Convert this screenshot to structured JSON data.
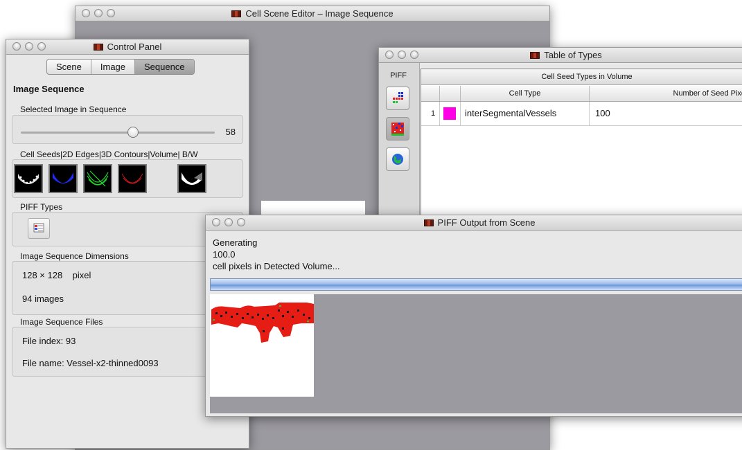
{
  "editor": {
    "title": "Cell Scene Editor – Image Sequence"
  },
  "control": {
    "title": "Control Panel",
    "tabs": [
      {
        "label": "Scene",
        "active": false
      },
      {
        "label": "Image",
        "active": false
      },
      {
        "label": "Sequence",
        "active": true
      }
    ],
    "section_title": "Image Sequence",
    "slider": {
      "label": "Selected Image in Sequence",
      "value": "58",
      "fraction": 0.58
    },
    "thumbnails": {
      "label": "Cell Seeds|2D Edges|3D Contours|Volume| B/W",
      "items": [
        "cell-seeds",
        "2d-edges",
        "3d-contours",
        "volume",
        "b-w"
      ]
    },
    "piff_types": {
      "label": "PIFF Types"
    },
    "dimensions": {
      "label": "Image Sequence Dimensions",
      "size": "128 × 128",
      "unit": "pixel",
      "images": "94  images"
    },
    "files": {
      "label": "Image Sequence Files",
      "index": "File index:  93",
      "name": "File name:  Vessel-x2-thinned0093"
    }
  },
  "types": {
    "title": "Table of Types",
    "sidebar_label": "PIFF",
    "caption": "Cell Seed Types in Volume",
    "columns": [
      "Cell Type",
      "Number of Seed Pixels"
    ],
    "rows": [
      {
        "index": "1",
        "color": "#ff00e6",
        "type": "interSegmentalVessels",
        "count": "100"
      }
    ]
  },
  "piff": {
    "title": "PIFF Output from Scene",
    "line1": "Generating",
    "line2": "100.0",
    "line3": "cell pixels in Detected Volume...",
    "progress": 1.0
  },
  "colors": {
    "accent_progress": "#6f98d9",
    "cell_red": "#e51d14",
    "cell_type_magenta": "#ff00e6"
  }
}
